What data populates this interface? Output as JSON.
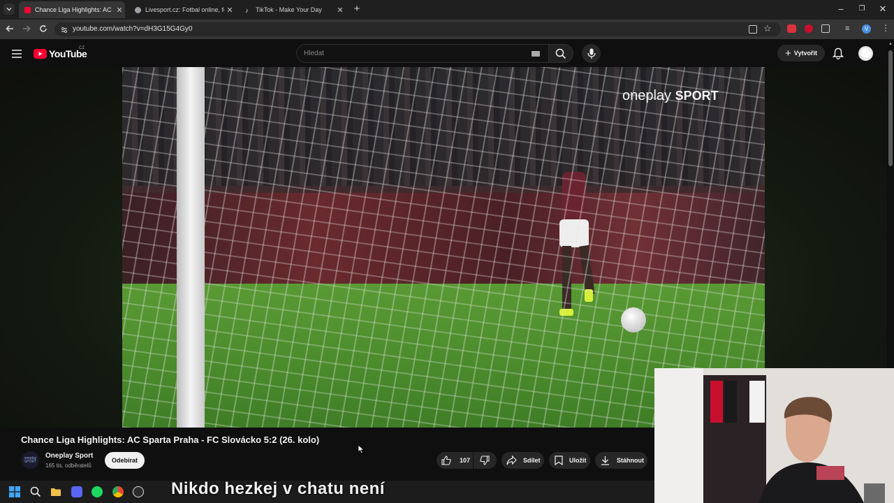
{
  "browser": {
    "tabs": [
      {
        "label": "Chance Liga Highlights: AC Sparta",
        "active": true,
        "favicon_color": "#ff0033"
      },
      {
        "label": "Livesport.cz: Fotbal online, fotb",
        "active": false,
        "favicon_color": "#9aa0a6"
      },
      {
        "label": "TikTok - Make Your Day",
        "active": false,
        "favicon_color": "#ffffff"
      }
    ],
    "url": "youtube.com/watch?v=dH3G15G4Gy0"
  },
  "youtube": {
    "logo_text": "YouTube",
    "region": "CZ",
    "search_placeholder": "Hledat",
    "create_label": "Vytvořit"
  },
  "video": {
    "brand_watermark_part1": "oneplay",
    "brand_watermark_part2": "SPORT",
    "title": "Chance Liga Highlights: AC Sparta Praha - FC Slovácko 5:2 (26. kolo)"
  },
  "channel": {
    "avatar_text": "oneplay SPORT",
    "name": "Oneplay Sport",
    "subscribers": "165 tis. odběratelů",
    "subscribe_label": "Odebírat"
  },
  "actions": {
    "likes": "107",
    "share_label": "Sdílet",
    "save_label": "Uložit",
    "download_label": "Stáhnout"
  },
  "stream_overlay": {
    "caption": "Nikdo hezkej v chatu není"
  },
  "colors": {
    "yt_red": "#ff0033",
    "background": "#0f0f0f",
    "chip": "#272727"
  }
}
